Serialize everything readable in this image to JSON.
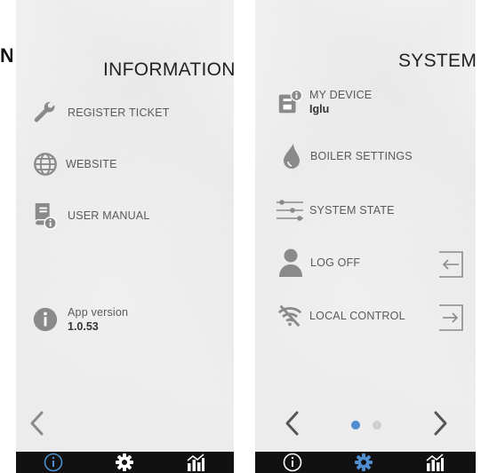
{
  "cut_text": "N",
  "info": {
    "title": "INFORMATION",
    "items": [
      {
        "label": "REGISTER TICKET",
        "icon": "wrench-icon"
      },
      {
        "label": "WEBSITE",
        "icon": "globe-icon"
      },
      {
        "label": "USER MANUAL",
        "icon": "manual-icon"
      }
    ],
    "app_version_label": "App version",
    "app_version_value": "1.0.53"
  },
  "system": {
    "title": "SYSTEM",
    "my_device_label": "MY DEVICE",
    "my_device_value": "Iglu",
    "items": [
      {
        "label": "BOILER SETTINGS",
        "icon": "drop-icon"
      },
      {
        "label": "SYSTEM STATE",
        "icon": "sliders-icon"
      },
      {
        "label": "LOG OFF",
        "icon": "user-icon"
      },
      {
        "label": "LOCAL CONTROL",
        "icon": "wifi-off-icon"
      }
    ],
    "pager": {
      "current": 1,
      "total": 2
    }
  },
  "colors": {
    "icon_gray": "#8a8a8a",
    "accent": "#4f8fcf",
    "nav_bg": "#111111",
    "dot_inactive": "#cfcfcf"
  }
}
